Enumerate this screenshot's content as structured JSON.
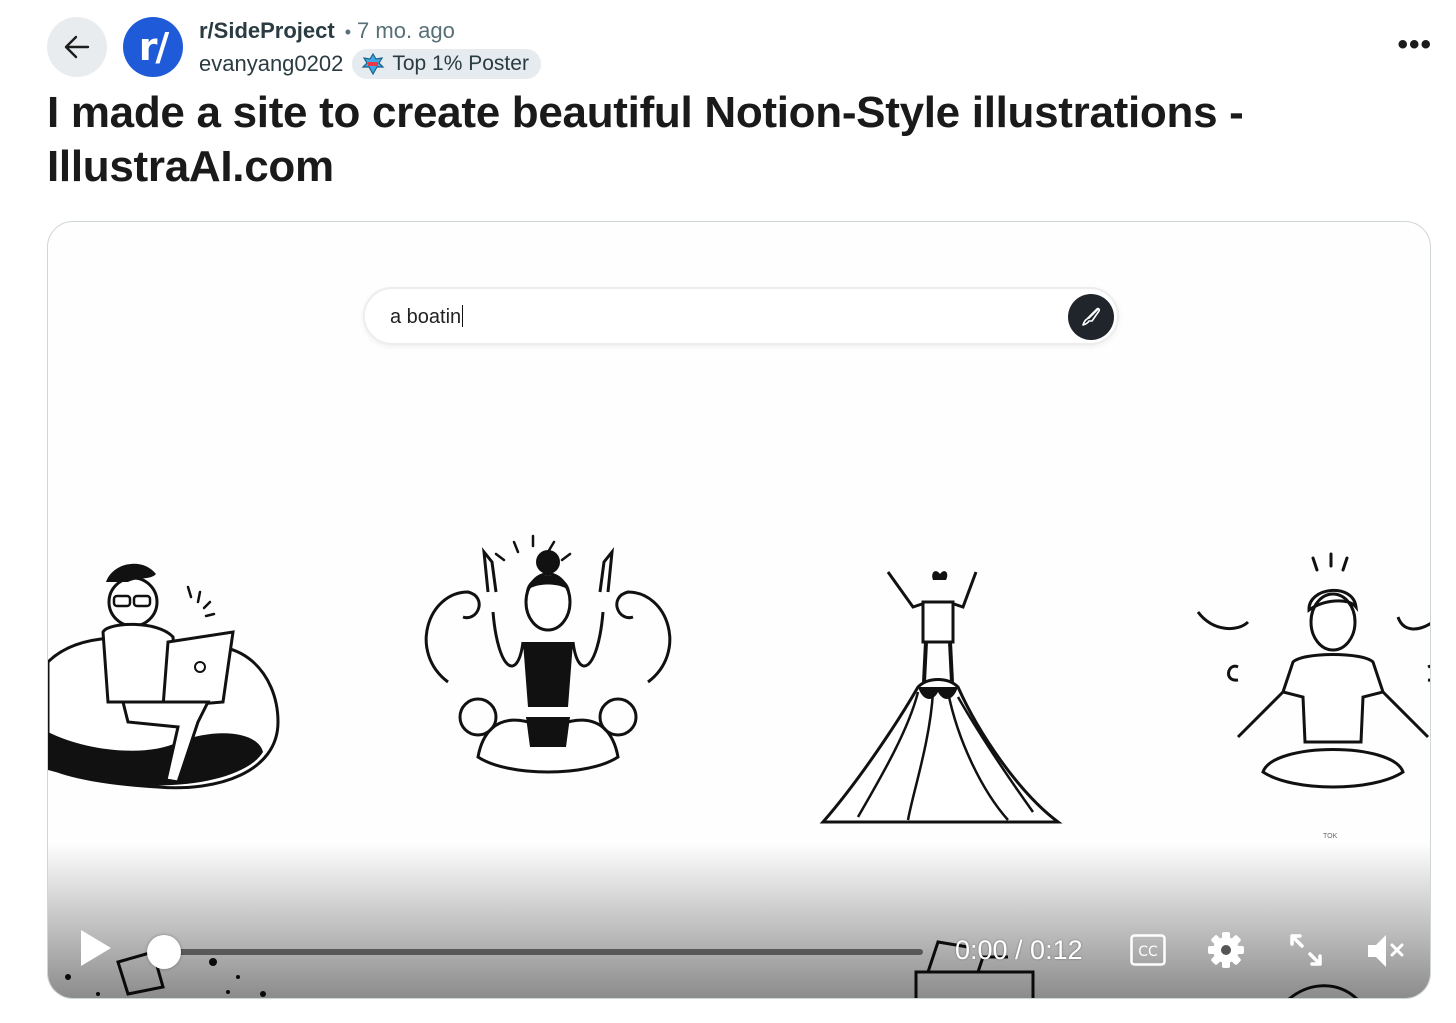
{
  "header": {
    "subreddit": "r/SideProject",
    "avatar_text": "r/",
    "separator": "•",
    "time_ago": "7 mo. ago",
    "author": "evanyang0202",
    "flair": "Top 1% Poster",
    "more_label": "•••"
  },
  "post": {
    "title": "I made a site to create beautiful Notion-Style illustrations - IllustraAI.com"
  },
  "video": {
    "search_value": "a boatin",
    "time_display": "0:00 / 0:12",
    "cc_label": "CC",
    "progress": 0,
    "watermark": "TOK"
  },
  "colors": {
    "subreddit_avatar": "#1f5bd8",
    "back_button_bg": "#e9ecef",
    "flair_bg": "#e5ebee",
    "generate_button": "#20252c"
  },
  "icons": [
    "back-arrow-icon",
    "flair-badge-icon",
    "more-options-icon",
    "brush-icon",
    "play-icon",
    "cc-icon",
    "gear-icon",
    "expand-icon",
    "mute-icon"
  ]
}
